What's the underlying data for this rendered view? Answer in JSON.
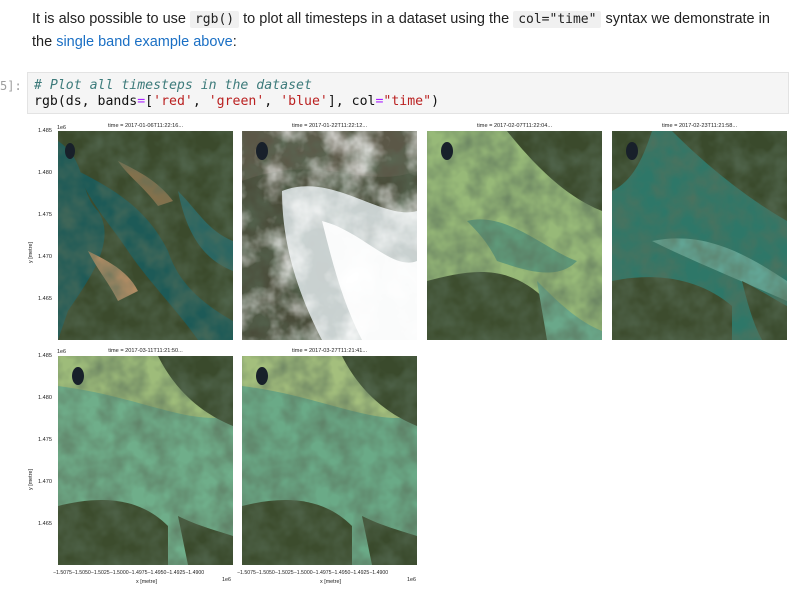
{
  "intro": {
    "text_before": "It is also possible to use ",
    "code1": "rgb()",
    "text_mid": " to plot all timesteps in a dataset using the ",
    "code2": "col=\"time\"",
    "text_after": " syntax we demonstrate in the ",
    "link_text": "single band example above",
    "text_end": ":"
  },
  "cell": {
    "prompt": "5]:",
    "comment": "# Plot all timesteps in the dataset",
    "code_a": "rgb(ds, bands",
    "code_eq1": "=",
    "code_b": "[",
    "s_red": "'red'",
    "comma1": ", ",
    "s_green": "'green'",
    "comma2": ", ",
    "s_blue": "'blue'",
    "code_c": "], col",
    "code_eq2": "=",
    "s_time": "\"time\"",
    "code_d": ")"
  },
  "figure": {
    "panel_titles": [
      "time = 2017-01-06T11:22:16...",
      "time = 2017-01-22T11:22:12...",
      "time = 2017-02-07T11:22:04...",
      "time = 2017-02-23T11:21:58...",
      "time = 2017-03-11T11:21:50...",
      "time = 2017-03-27T11:21:41..."
    ],
    "ylabel": "y [metre]",
    "xlabel": "x [metre]",
    "multiplier": "1e6",
    "y_ticks": [
      "1.485",
      "1.480",
      "1.475",
      "1.470",
      "1.465"
    ],
    "x_ticks": "−1.5075−1.5050−1.5025−1.5000−1.4975−1.4950−1.4925−1.4900"
  }
}
